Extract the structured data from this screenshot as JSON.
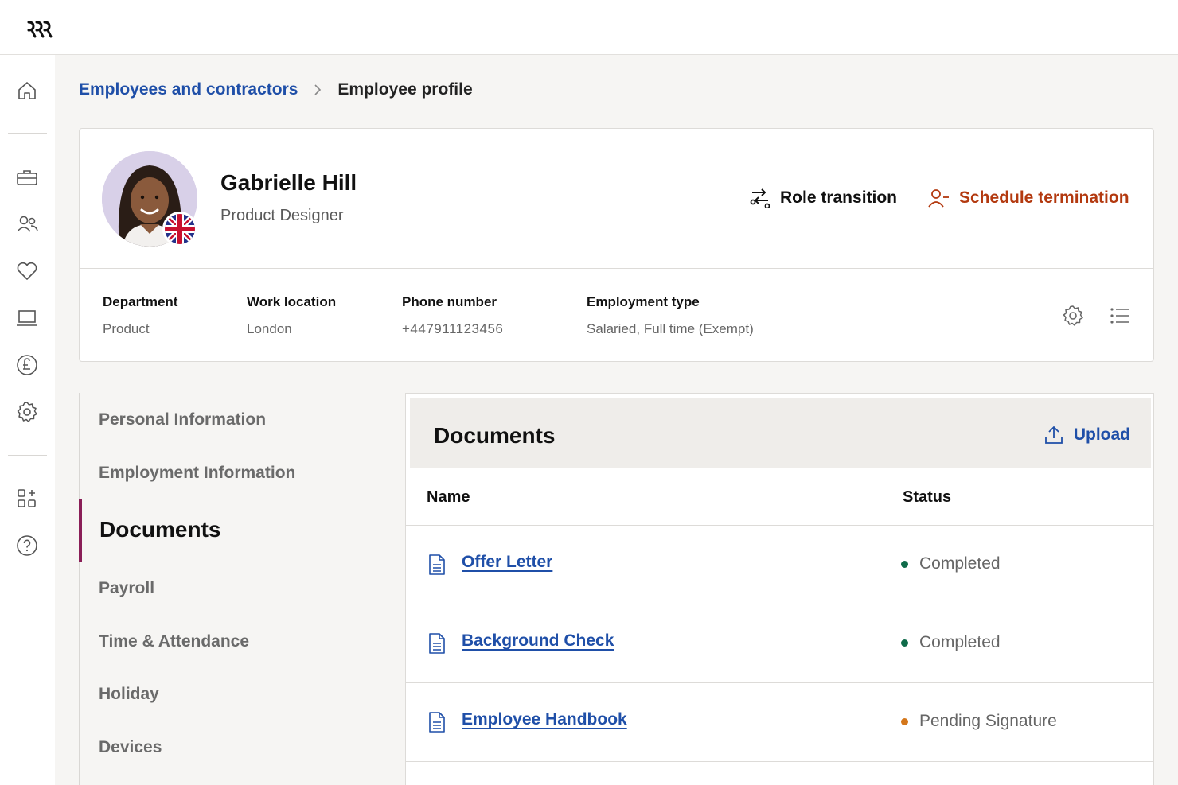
{
  "breadcrumb": {
    "parent": "Employees and contractors",
    "current": "Employee profile"
  },
  "rail": {
    "icons": [
      "home-icon",
      "briefcase-icon",
      "people-icon",
      "heart-icon",
      "laptop-icon",
      "pound-icon",
      "gear-icon",
      "apps-icon",
      "help-icon"
    ]
  },
  "profile": {
    "name": "Gabrielle Hill",
    "title": "Product Designer",
    "flag": "uk-flag-icon",
    "actions": {
      "role_transition": "Role transition",
      "schedule_termination": "Schedule termination"
    },
    "info": [
      {
        "label": "Department",
        "value": "Product"
      },
      {
        "label": "Work location",
        "value": "London"
      },
      {
        "label": "Phone number",
        "value": "+447911123456"
      },
      {
        "label": "Employment type",
        "value": "Salaried, Full time (Exempt)"
      }
    ]
  },
  "subnav": {
    "items": [
      "Personal Information",
      "Employment Information",
      "Documents",
      "Payroll",
      "Time & Attendance",
      "Holiday",
      "Devices"
    ],
    "active": "Documents"
  },
  "documents": {
    "title": "Documents",
    "upload_label": "Upload",
    "columns": {
      "name": "Name",
      "status": "Status"
    },
    "rows": [
      {
        "name": "Offer Letter",
        "status": "Completed",
        "status_color": "#0f6b4a"
      },
      {
        "name": "Background Check",
        "status": "Completed",
        "status_color": "#0f6b4a"
      },
      {
        "name": "Employee Handbook",
        "status": "Pending Signature",
        "status_color": "#d4771b"
      }
    ]
  },
  "colors": {
    "accent": "#1f4fa8",
    "danger": "#b3390f",
    "active_bar": "#8a1e57"
  }
}
